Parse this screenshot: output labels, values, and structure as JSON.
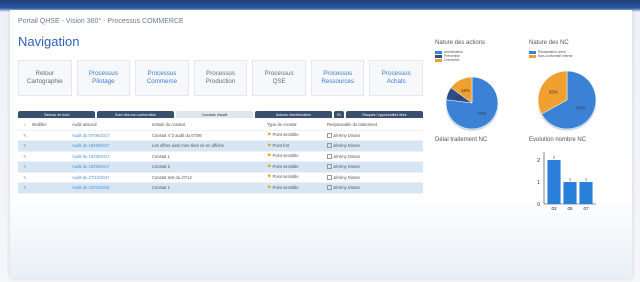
{
  "header": {
    "breadcrumb": "Portail QHSE - Vision 360° - Processus COMMERCE",
    "title": "Navigation"
  },
  "nav_tiles": [
    {
      "line1": "Retour",
      "line2": "Cartographie",
      "highlight": false
    },
    {
      "line1": "Processus",
      "line2": "Pilotage",
      "highlight": true
    },
    {
      "line1": "Processus",
      "line2": "Commerce",
      "highlight": true
    },
    {
      "line1": "Processus",
      "line2": "Production",
      "highlight": false
    },
    {
      "line1": "Processus",
      "line2": "QSE",
      "highlight": false
    },
    {
      "line1": "Processus",
      "line2": "Ressources",
      "highlight": true
    },
    {
      "line1": "Processus",
      "line2": "Achats",
      "highlight": true
    }
  ],
  "tabs": [
    {
      "label": "Tableau de bord",
      "active": false
    },
    {
      "label": "Suivi des non conformités",
      "active": false
    },
    {
      "label": "Constats d'audit",
      "active": true
    },
    {
      "label": "Actions d'amélioration",
      "active": false
    },
    {
      "label": "BI",
      "active": false
    },
    {
      "label": "Risques / opportunités liées",
      "active": false
    }
  ],
  "table": {
    "headers": [
      "Modifier",
      "Audit associé",
      "Intitulé du constat",
      "Type de constat",
      "Responsable du traitement"
    ],
    "rows": [
      {
        "audit": "Audit du 07/06/2017",
        "intitule": "Constat n°3 audit du 07/06",
        "type": "Point sensible",
        "resp": "Jérémy Dinam"
      },
      {
        "audit": "Audit du 16/06/2017",
        "intitule": "Les offres ainsi mes sites ne en affiche",
        "type": "Point fort",
        "resp": "Jérémy Dinam"
      },
      {
        "audit": "Audit du 10/09/2017",
        "intitule": "Constat 1",
        "type": "Point sensible",
        "resp": "Jérémy Dinam"
      },
      {
        "audit": "Audit du 10/09/2017",
        "intitule": "Constat 2",
        "type": "Point sensible",
        "resp": "Jérémy Dinam"
      },
      {
        "audit": "Audit du 27/12/2017",
        "intitule": "Constat test du 27/12",
        "type": "Point sensible",
        "resp": "Jérémy Dinam"
      },
      {
        "audit": "Audit du 22/02/2018",
        "intitule": "Constat 1",
        "type": "Point sensible",
        "resp": "Jérémy Dinam"
      }
    ]
  },
  "panels": {
    "nature_actions": "Nature des actions",
    "nature_nc": "Nature des NC",
    "delai": "Délai traitement NC",
    "evolution": "Evolution nombre NC"
  },
  "chart_data": [
    {
      "type": "pie",
      "title": "Nature des actions",
      "categories": [
        "Amélioration",
        "Préventive",
        "Corrective"
      ],
      "values": [
        77,
        8,
        15
      ],
      "labels": [
        "77%",
        "8%",
        "15%"
      ],
      "colors": [
        "#3b82d6",
        "#2f4d8a",
        "#f0a030"
      ]
    },
    {
      "type": "pie",
      "title": "Nature des NC",
      "categories": [
        "Réclamation client",
        "Non-conformité interne"
      ],
      "values": [
        67,
        33
      ],
      "labels": [
        "67%",
        "33%"
      ],
      "colors": [
        "#3b82d6",
        "#f0a030"
      ]
    },
    {
      "type": "bar",
      "title": "Evolution nombre NC",
      "categories": [
        "03",
        "05",
        "07"
      ],
      "values": [
        2,
        1,
        1
      ],
      "ylim": [
        0,
        2
      ],
      "yticks": [
        "0",
        "1",
        "2"
      ],
      "color": "#2a7fd8"
    }
  ]
}
